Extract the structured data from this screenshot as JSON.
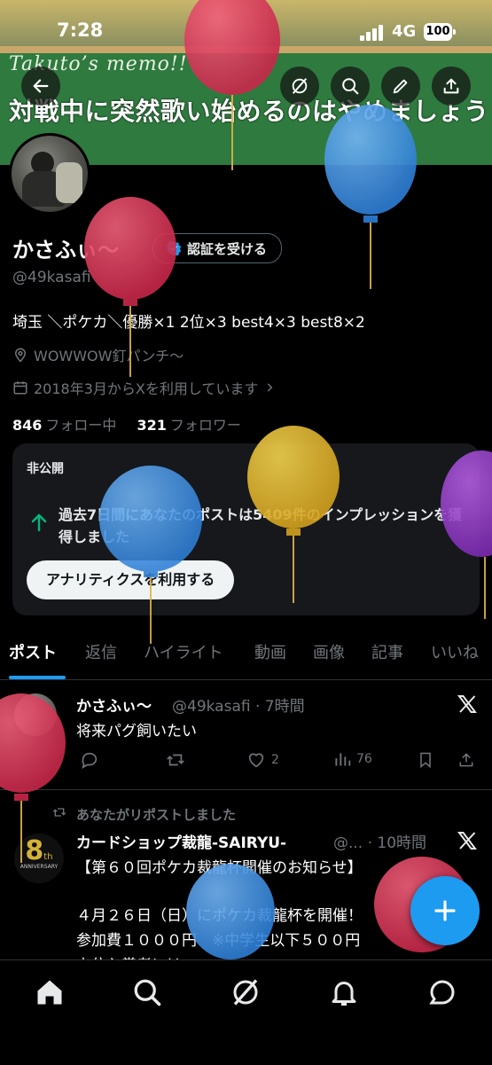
{
  "status_bar": {
    "time": "7:28",
    "network": "4G",
    "battery": "100"
  },
  "banner": {
    "memo": "Takuto’s memo!!",
    "slogan": "対戦中に突然歌い始めるのはやめましょう"
  },
  "profile": {
    "display_name": "かさふぃ〜",
    "verify_label": "認証を受ける",
    "handle": "@49kasafi",
    "bio": "埼玉 ＼ポケカ＼優勝×1 2位×3 best4×3 best8×2",
    "location": "WOWWOW釘パンチ〜",
    "joined": "2018年3月からXを利用しています",
    "following_count": "846",
    "following_label": "フォロー中",
    "followers_count": "321",
    "followers_label": "フォロワー"
  },
  "private_card": {
    "label": "非公開",
    "message": "過去7日間にあなたのポストは5409件のインプレッションを獲得しました",
    "button": "アナリティクスを利用する"
  },
  "tabs": [
    "ポスト",
    "返信",
    "ハイライト",
    "動画",
    "画像",
    "記事",
    "いいね"
  ],
  "posts": [
    {
      "name": "かさふぃ〜",
      "handle_time": "@49kasafi · 7時間",
      "text": "将来パグ飼いたい",
      "likes": "2",
      "views": "76"
    },
    {
      "repost_label": "あなたがリポストしました",
      "name": "カードショップ裁龍-SAIRYU-",
      "handle_time": "@... · 10時間",
      "avatar_text": "8",
      "avatar_sup": "th",
      "avatar_sub": "ANNIVERSARY",
      "lines": [
        "【第６０回ポケカ裁龍杯開催のお知らせ】",
        "",
        "４月２６日（日）にポケカ裁龍杯を開催！",
        "参加費１０００円　※中学生以下５００円",
        "上位入賞者には"
      ]
    }
  ],
  "colors": {
    "accent": "#1d9bf0",
    "background": "#000000",
    "muted": "#71767b",
    "card": "#16181c"
  },
  "icons": [
    "back-icon",
    "grok-icon",
    "search-icon",
    "edit-icon",
    "share-icon",
    "verified-badge-icon",
    "location-icon",
    "calendar-icon",
    "chevron-right-icon",
    "arrow-up-icon",
    "x-logo-icon",
    "reply-icon",
    "repost-icon",
    "like-icon",
    "views-icon",
    "bookmark-icon",
    "home-icon",
    "notifications-icon",
    "messages-icon",
    "compose-icon"
  ]
}
